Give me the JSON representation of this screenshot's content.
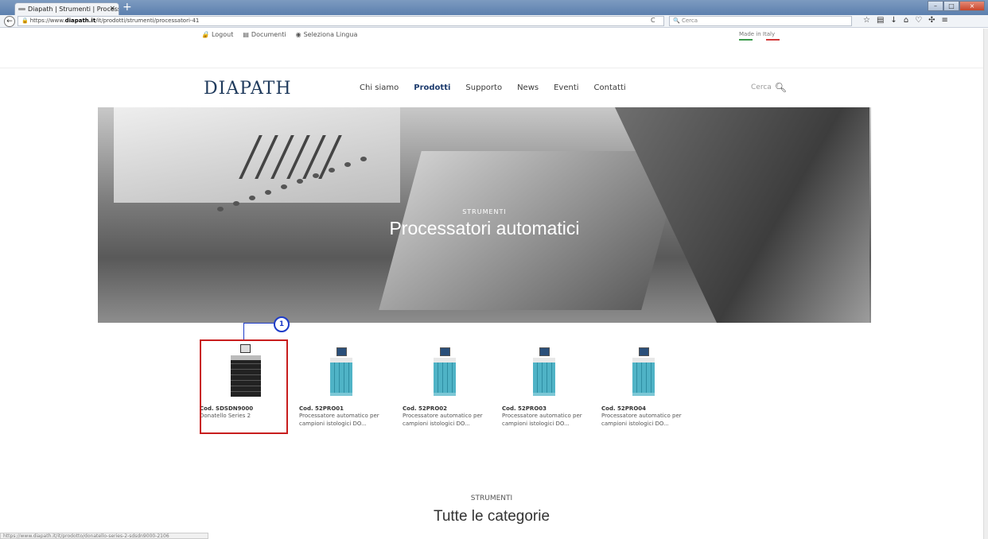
{
  "browser": {
    "tab_title": "Diapath | Strumenti | Process",
    "url_prefix": "https://www.",
    "url_domain": "diapath.it",
    "url_path": "/it/prodotti/strumenti/processatori-41",
    "search_placeholder": "Cerca",
    "status_url": "https://www.diapath.it/it/prodotto/donatello-series-2-sdsdn9000-2106"
  },
  "topmenu": {
    "logout": "Logout",
    "documenti": "Documenti",
    "lingua": "Seleziona Lingua",
    "made_in": "Made in Italy"
  },
  "logo": "DIAPATH",
  "nav": [
    "Chi siamo",
    "Prodotti",
    "Supporto",
    "News",
    "Eventi",
    "Contatti"
  ],
  "search_label": "Cerca",
  "hero": {
    "subtitle": "STRUMENTI",
    "title": "Processatori automatici"
  },
  "callout": "1",
  "products": [
    {
      "code": "Cod. SDSDN9000",
      "desc": "Donatello Series 2"
    },
    {
      "code": "Cod. 52PRO01",
      "desc": "Processatore automatico per campioni istologici DO..."
    },
    {
      "code": "Cod. 52PRO02",
      "desc": "Processatore automatico per campioni istologici DO..."
    },
    {
      "code": "Cod. 52PRO03",
      "desc": "Processatore automatico per campioni istologici DO..."
    },
    {
      "code": "Cod. 52PRO04",
      "desc": "Processatore automatico per campioni istologici DO..."
    }
  ],
  "footer_section": {
    "subtitle": "STRUMENTI",
    "title": "Tutte le categorie"
  },
  "colors": {
    "accent": "#1e3c6e",
    "highlight": "#c81e1e",
    "callout": "#1e3cc8"
  }
}
